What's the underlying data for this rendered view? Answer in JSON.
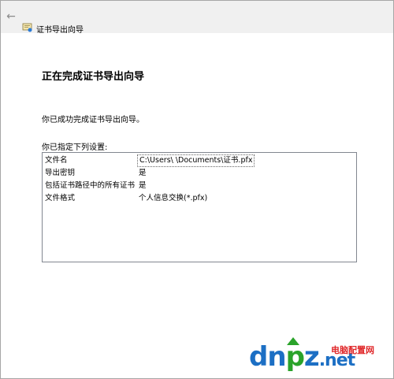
{
  "window": {
    "title": "证书导出向导",
    "back_icon": "back-arrow-icon"
  },
  "main": {
    "heading": "正在完成证书导出向导",
    "description": "你已成功完成证书导出向导。",
    "list_label": "你已指定下列设置:",
    "settings": [
      {
        "key": "文件名",
        "value": "C:\\Users\\        \\Documents\\证书.pfx"
      },
      {
        "key": "导出密钥",
        "value": "是"
      },
      {
        "key": "包括证书路径中的所有证书",
        "value": "是"
      },
      {
        "key": "文件格式",
        "value": "个人信息交换(*.pfx)"
      }
    ]
  },
  "watermark": {
    "logo_d": "d",
    "logo_n": "n",
    "logo_p": "p",
    "logo_z": "z",
    "logo_net": ".net",
    "site_name": "电脑配置网"
  }
}
